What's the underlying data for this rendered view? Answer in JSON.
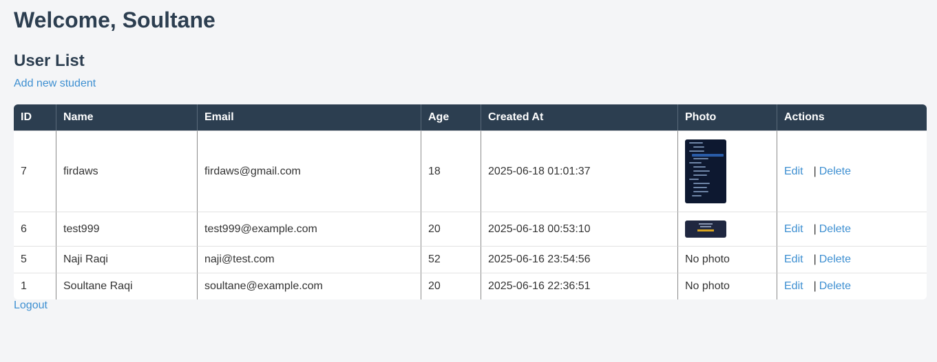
{
  "header": {
    "welcome": "Welcome, Soultane"
  },
  "section": {
    "title": "User List",
    "add_link": "Add new student"
  },
  "table": {
    "columns": [
      "ID",
      "Name",
      "Email",
      "Age",
      "Created At",
      "Photo",
      "Actions"
    ],
    "rows": [
      {
        "id": "7",
        "name": "firdaws",
        "email": "firdaws@gmail.com",
        "age": "18",
        "created_at": "2025-06-18 01:01:37",
        "photo": "thumbnail",
        "edit": "Edit",
        "delete": "Delete"
      },
      {
        "id": "6",
        "name": "test999",
        "email": "test999@example.com",
        "age": "20",
        "created_at": "2025-06-18 00:53:10",
        "photo": "thumbnail",
        "edit": "Edit",
        "delete": "Delete"
      },
      {
        "id": "5",
        "name": "Naji Raqi",
        "email": "naji@test.com",
        "age": "52",
        "created_at": "2025-06-16 23:54:56",
        "photo": "No photo",
        "edit": "Edit",
        "delete": "Delete"
      },
      {
        "id": "1",
        "name": "Soultane Raqi",
        "email": "soultane@example.com",
        "age": "20",
        "created_at": "2025-06-16 22:36:51",
        "photo": "No photo",
        "edit": "Edit",
        "delete": "Delete"
      }
    ],
    "separator": "|"
  },
  "footer": {
    "logout": "Logout"
  },
  "colors": {
    "header_bg": "#2c3e50",
    "link": "#3d8fd1",
    "page_bg": "#f4f5f7"
  }
}
